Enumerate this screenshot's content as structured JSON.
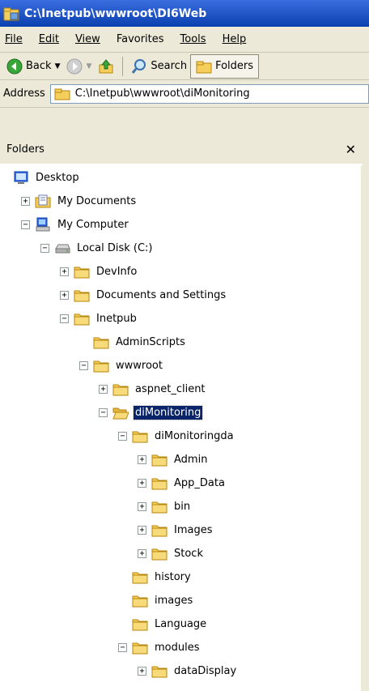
{
  "window": {
    "title": "C:\\Inetpub\\wwwroot\\DI6Web"
  },
  "menu": [
    "File",
    "Edit",
    "View",
    "Favorites",
    "Tools",
    "Help"
  ],
  "toolbar": {
    "back": "Back",
    "search": "Search",
    "folders": "Folders"
  },
  "address": {
    "label": "Address",
    "value": "C:\\Inetpub\\wwwroot\\diMonitoring"
  },
  "pane": {
    "title": "Folders",
    "close": "✕"
  },
  "tree": [
    {
      "label": "Desktop",
      "level": 0,
      "toggle": "",
      "icon": "desktop-icon"
    },
    {
      "label": "My Documents",
      "level": 1,
      "toggle": "+",
      "icon": "my-documents-icon"
    },
    {
      "label": "My Computer",
      "level": 1,
      "toggle": "−",
      "icon": "my-computer-icon"
    },
    {
      "label": "Local Disk (C:)",
      "level": 2,
      "toggle": "−",
      "icon": "drive-icon"
    },
    {
      "label": "DevInfo",
      "level": 3,
      "toggle": "+",
      "icon": "folder-icon"
    },
    {
      "label": "Documents and Settings",
      "level": 3,
      "toggle": "+",
      "icon": "folder-icon"
    },
    {
      "label": "Inetpub",
      "level": 3,
      "toggle": "−",
      "icon": "folder-icon"
    },
    {
      "label": "AdminScripts",
      "level": 4,
      "toggle": "",
      "icon": "folder-icon"
    },
    {
      "label": "wwwroot",
      "level": 4,
      "toggle": "−",
      "icon": "folder-icon"
    },
    {
      "label": "aspnet_client",
      "level": 5,
      "toggle": "+",
      "icon": "folder-icon"
    },
    {
      "label": "diMonitoring",
      "level": 5,
      "toggle": "−",
      "icon": "open-folder-icon",
      "selected": true
    },
    {
      "label": "diMonitoringda",
      "level": 6,
      "toggle": "−",
      "icon": "folder-icon"
    },
    {
      "label": "Admin",
      "level": 7,
      "toggle": "+",
      "icon": "folder-icon"
    },
    {
      "label": "App_Data",
      "level": 7,
      "toggle": "+",
      "icon": "folder-icon"
    },
    {
      "label": "bin",
      "level": 7,
      "toggle": "+",
      "icon": "folder-icon"
    },
    {
      "label": "Images",
      "level": 7,
      "toggle": "+",
      "icon": "folder-icon"
    },
    {
      "label": "Stock",
      "level": 7,
      "toggle": "+",
      "icon": "folder-icon"
    },
    {
      "label": "history",
      "level": 6,
      "toggle": "",
      "icon": "folder-icon"
    },
    {
      "label": "images",
      "level": 6,
      "toggle": "",
      "icon": "folder-icon"
    },
    {
      "label": "Language",
      "level": 6,
      "toggle": "",
      "icon": "folder-icon"
    },
    {
      "label": "modules",
      "level": 6,
      "toggle": "−",
      "icon": "folder-icon"
    },
    {
      "label": "dataDisplay",
      "level": 7,
      "toggle": "+",
      "icon": "folder-icon"
    }
  ],
  "colors": {
    "title_bar": "#0a3fae",
    "selection": "#0a246a",
    "chrome": "#ece9d8",
    "folder": "#f5cf5c"
  }
}
